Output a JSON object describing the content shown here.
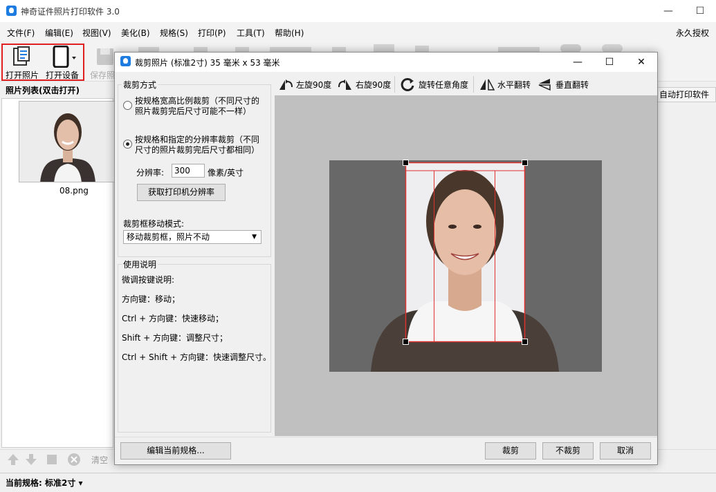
{
  "app": {
    "title": "神奇证件照片打印软件 3.0",
    "license": "永久授权",
    "menu": [
      "文件(F)",
      "编辑(E)",
      "视图(V)",
      "美化(B)",
      "规格(S)",
      "打印(P)",
      "工具(T)",
      "帮助(H)"
    ]
  },
  "toolbar": {
    "open_photo": "打开照片",
    "open_device": "打开设备",
    "save_photo": "保存照"
  },
  "photo_list": {
    "header": "照片列表(双击打开)",
    "items": [
      {
        "name": "08.png"
      }
    ]
  },
  "bottom_tools": {
    "clear": "清空"
  },
  "right_hint": "自动打印软件",
  "status": {
    "spec_label": "当前规格:",
    "spec_value": "标准2寸"
  },
  "dialog": {
    "title": "裁剪照片 (标准2寸) 35 毫米 x 53 毫米",
    "crop_mode_label": "裁剪方式",
    "option1": "按规格宽高比例裁剪（不同尺寸的照片裁剪完后尺寸可能不一样）",
    "option1_line1": "按规格宽高比例裁剪（不同尺寸的",
    "option1_line2": "照片裁剪完后尺寸可能不一样）",
    "option2_line1": "按规格和指定的分辨率裁剪（不同",
    "option2_line2": "尺寸的照片裁剪完后尺寸都相同）",
    "resolution_label": "分辨率:",
    "resolution_value": "300",
    "resolution_unit": "像素/英寸",
    "get_printer_resolution": "获取打印机分辨率",
    "move_mode_label": "裁剪框移动模式:",
    "move_mode_value": "移动裁剪框，照片不动",
    "help_title": "使用说明",
    "help_lines": [
      "微调按键说明:",
      "方向键：移动；",
      "Ctrl + 方向键：快速移动；",
      "Shift + 方向键：调整尺寸；",
      "Ctrl + Shift + 方向键：快速调整尺寸。"
    ],
    "tools": {
      "rotate_left": "左旋90度",
      "rotate_right": "右旋90度",
      "rotate_any": "旋转任意角度",
      "flip_h": "水平翻转",
      "flip_v": "垂直翻转"
    },
    "buttons": {
      "edit_spec": "编辑当前规格...",
      "crop": "裁剪",
      "no_crop": "不裁剪",
      "cancel": "取消"
    }
  },
  "colors": {
    "accent": "#1e7be0",
    "highlight": "#e02020",
    "crop_line": "#e03030"
  }
}
